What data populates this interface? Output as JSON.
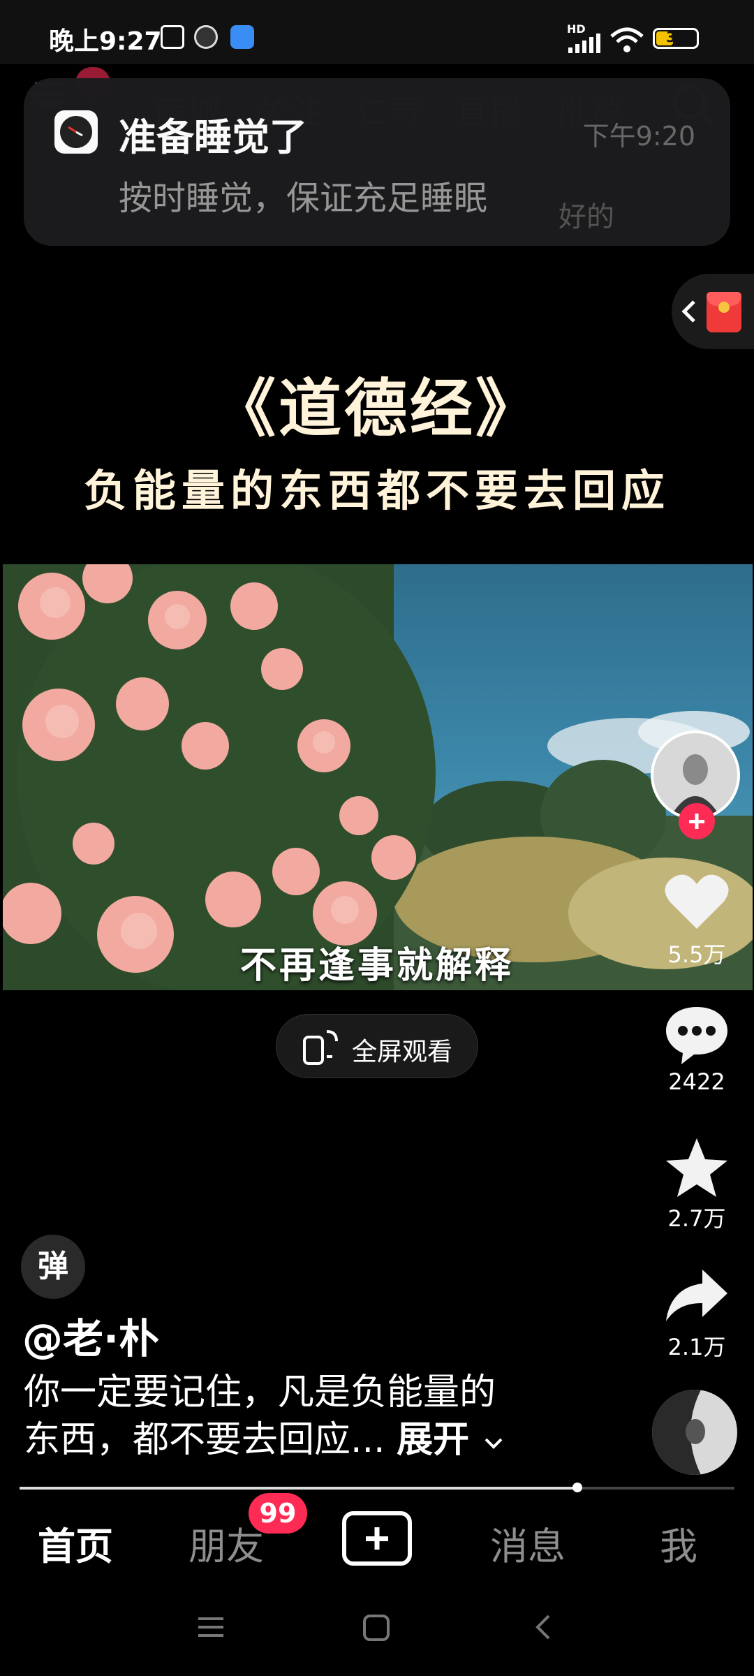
{
  "status_bar": {
    "time": "晚上9:27",
    "battery": "30",
    "network": "HD"
  },
  "top_nav": {
    "items": [
      "商城",
      "关注",
      "仁寿",
      "直播",
      "推荐"
    ]
  },
  "notification": {
    "title": "准备睡觉了",
    "body": "按时睡觉，保证充足睡眠",
    "time": "下午9:20",
    "action": "好的"
  },
  "video": {
    "title": "《道德经》",
    "subtitle": "负能量的东西都不要去回应",
    "caption": "不再逢事就解释"
  },
  "fullscreen": {
    "label": "全屏观看"
  },
  "sidebar": {
    "likes": "5.5万",
    "comments": "2422",
    "favorites": "2.7万",
    "shares": "2.1万"
  },
  "post": {
    "danmu_label": "弹",
    "author": "@老·朴",
    "description_line1": "你一定要记住，凡是负能量的",
    "description_line2": "东西，都不要去回应...",
    "expand_label": "展开"
  },
  "progress": {
    "fraction": 0.78
  },
  "tabs": {
    "home": "首页",
    "friends": "朋友",
    "friends_badge": "99",
    "messages": "消息",
    "me": "我"
  },
  "colors": {
    "accent": "#fe2c55",
    "battery_fill": "#f2c200",
    "caption_text": "#fff3da"
  }
}
